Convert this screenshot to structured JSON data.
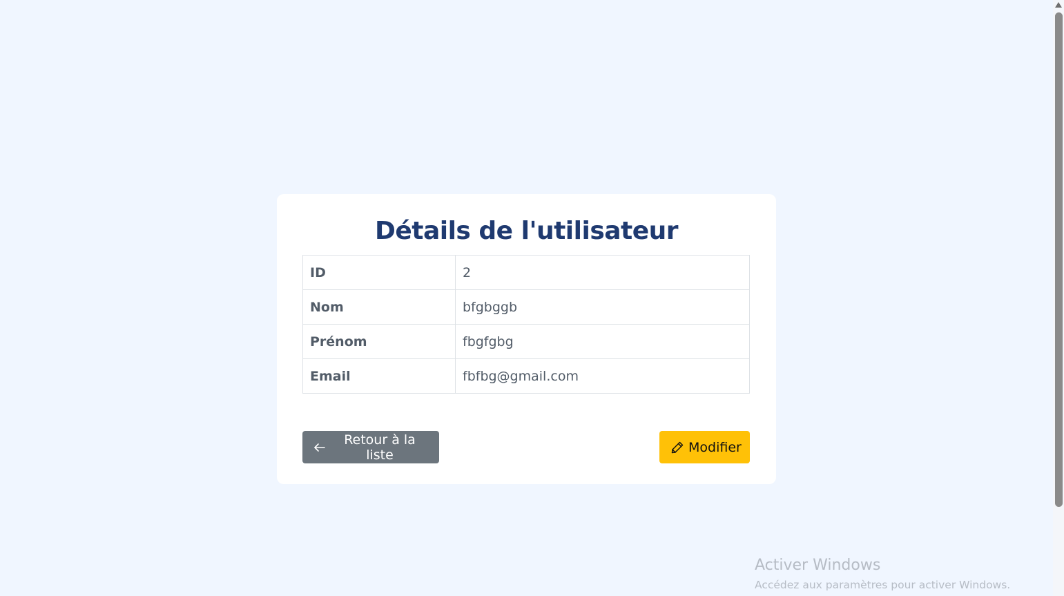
{
  "page": {
    "title": "Détails de l'utilisateur"
  },
  "details": [
    {
      "label": "ID",
      "value": "2"
    },
    {
      "label": "Nom",
      "value": "bfgbggb"
    },
    {
      "label": "Prénom",
      "value": "fbgfgbg"
    },
    {
      "label": "Email",
      "value": "fbfbg@gmail.com"
    }
  ],
  "actions": {
    "back_label": "Retour à la liste",
    "back_icon": "arrow-left-icon",
    "edit_label": "Modifier",
    "edit_icon": "pencil-icon"
  },
  "watermark": {
    "title": "Activer Windows",
    "subtitle": "Accédez aux paramètres pour activer Windows."
  },
  "colors": {
    "background": "#f0f6ff",
    "title": "#1f3a70",
    "back_button": "#6c757d",
    "edit_button": "#ffc107"
  }
}
